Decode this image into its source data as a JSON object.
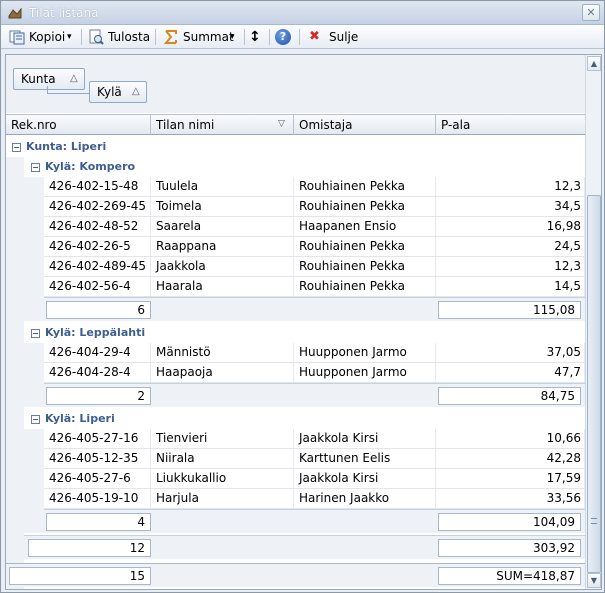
{
  "window": {
    "title": "Tilat listana",
    "close_glyph": "✕"
  },
  "toolbar": {
    "copy_label": "Kopioi",
    "print_label": "Tulosta",
    "sums_label": "Summat",
    "close_label": "Sulje",
    "dropdown_glyph": "▾",
    "updown_glyph": "↕",
    "help_glyph": "?",
    "close_glyph": "✖"
  },
  "group_by": {
    "level1": "Kunta",
    "level2": "Kylä",
    "sort_glyph": "△"
  },
  "columns": {
    "c1": "Rek.nro",
    "c2": "Tilan nimi",
    "c3": "Omistaja",
    "c4": "P-ala",
    "filter_glyph": "▽"
  },
  "groups": {
    "kunta": {
      "label": "Kunta: Liperi",
      "count": "12",
      "sum": "303,92"
    },
    "g1": {
      "label": "Kylä: Kompero",
      "rows": [
        {
          "rek": "426-402-15-48",
          "name": "Tuulela",
          "owner": "Rouhiainen Pekka",
          "area": "12,3"
        },
        {
          "rek": "426-402-269-45",
          "name": "Toimela",
          "owner": "Rouhiainen Pekka",
          "area": "34,5"
        },
        {
          "rek": "426-402-48-52",
          "name": "Saarela",
          "owner": "Haapanen Ensio",
          "area": "16,98"
        },
        {
          "rek": "426-402-26-5",
          "name": "Raappana",
          "owner": "Rouhiainen Pekka",
          "area": "24,5"
        },
        {
          "rek": "426-402-489-45",
          "name": "Jaakkola",
          "owner": "Rouhiainen Pekka",
          "area": "12,3"
        },
        {
          "rek": "426-402-56-4",
          "name": "Haarala",
          "owner": "Rouhiainen Pekka",
          "area": "14,5"
        }
      ],
      "count": "6",
      "sum": "115,08"
    },
    "g2": {
      "label": "Kylä: Leppälahti",
      "rows": [
        {
          "rek": "426-404-29-4",
          "name": "Männistö",
          "owner": "Huupponen Jarmo",
          "area": "37,05"
        },
        {
          "rek": "426-404-28-4",
          "name": "Haapaoja",
          "owner": "Huupponen Jarmo",
          "area": "47,7"
        }
      ],
      "count": "2",
      "sum": "84,75"
    },
    "g3": {
      "label": "Kylä: Liperi",
      "rows": [
        {
          "rek": "426-405-27-16",
          "name": "Tienvieri",
          "owner": "Jaakkola Kirsi",
          "area": "10,66"
        },
        {
          "rek": "426-405-12-35",
          "name": "Niirala",
          "owner": "Karttunen Eelis",
          "area": "42,28"
        },
        {
          "rek": "426-405-27-6",
          "name": "Liukkukallio",
          "owner": "Jaakkola Kirsi",
          "area": "17,59"
        },
        {
          "rek": "426-405-19-10",
          "name": "Harjula",
          "owner": "Harinen Jaakko",
          "area": "33,56"
        }
      ],
      "count": "4",
      "sum": "104,09"
    }
  },
  "grand_total": {
    "count": "15",
    "sum": "SUM=418,87"
  },
  "expander_glyph": "−",
  "scroll": {
    "up_glyph": "▲",
    "down_glyph": "▼"
  },
  "colors": {
    "group_text": "#3e5d90",
    "accent": "#1f4aa8"
  }
}
